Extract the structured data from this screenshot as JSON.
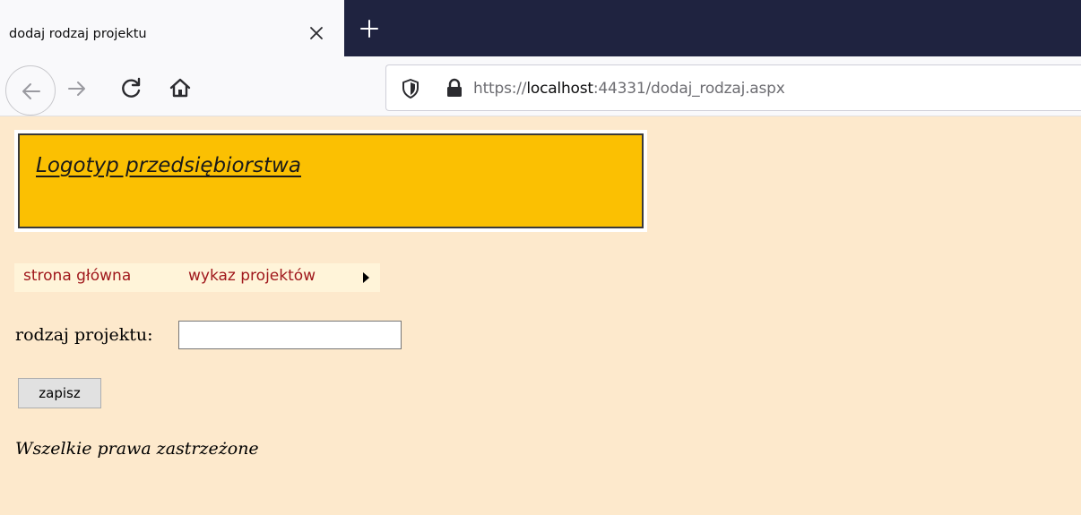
{
  "browser": {
    "tab_title": "dodaj rodzaj projektu",
    "url_scheme": "https://",
    "url_host": "localhost",
    "url_rest": ":44331/dodaj_rodzaj.aspx",
    "icons": [
      "close-icon",
      "plus-icon",
      "back-arrow-icon",
      "forward-arrow-icon",
      "reload-icon",
      "home-icon",
      "shield-icon",
      "lock-icon"
    ],
    "colors": {
      "tabstrip": "#1f2340",
      "toolbar": "#f9f9fb"
    }
  },
  "page": {
    "logo_text": "Logotyp przedsiębiorstwa",
    "menu": {
      "items": [
        {
          "label": "strona główna"
        },
        {
          "label": "wykaz projektów"
        }
      ]
    },
    "form": {
      "label": "rodzaj projektu:",
      "input_value": "",
      "submit_label": "zapisz"
    },
    "footer": "Wszelkie prawa zastrzeżone",
    "colors": {
      "background": "#fde9cc",
      "logo_fill": "#fbc002",
      "menu_background": "#fff4d9",
      "menu_text": "#a0181c"
    }
  }
}
